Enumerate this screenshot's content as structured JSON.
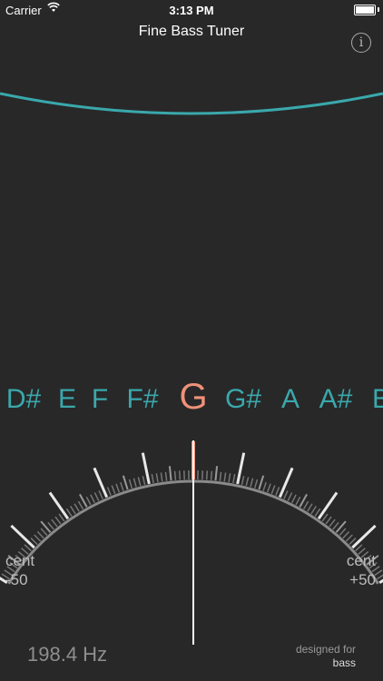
{
  "status_bar": {
    "carrier": "Carrier",
    "time": "3:13 PM"
  },
  "header": {
    "title": "Fine Bass Tuner",
    "info_label": "i"
  },
  "notes": [
    "D#",
    "E",
    "F",
    "F#",
    "G",
    "G#",
    "A",
    "A#",
    "B"
  ],
  "current_note": "G",
  "dial": {
    "left_label": "cent",
    "left_value": "-50",
    "right_label": "cent",
    "right_value": "+50",
    "needle_cents": 0
  },
  "frequency": "198.4 Hz",
  "footer": {
    "designed_for": "designed for",
    "instrument": "bass"
  },
  "colors": {
    "accent": "#3aa8ac",
    "active": "#f0917a",
    "background": "#282828"
  }
}
